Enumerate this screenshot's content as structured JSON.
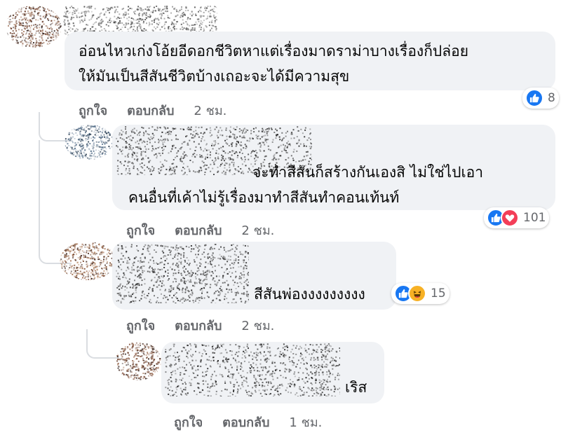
{
  "comments": [
    {
      "text_lines": [
        "อ่อนไหวเก่งโอ้ยอีดอกชีวิตหาแต่เรื่องมาดราม่าบางเรื่องก็ปล่อย",
        "ให้มันเป็นสีสันชีวิตบ้างเถอะจะได้มีความสุข"
      ],
      "like_label": "ถูกใจ",
      "reply_label": "ตอบกลับ",
      "time": "2 ชม.",
      "reaction_icons": [
        "like-icon"
      ],
      "reaction_count": "8"
    },
    {
      "text_lines": [
        "จะทำสีสันก็สร้างกันเองสิ ไม่ใช่ไปเอา",
        "คนอื่นที่เค้าไม่รู้เรื่องมาทำสีสันทำคอนเท้นท์"
      ],
      "like_label": "ถูกใจ",
      "reply_label": "ตอบกลับ",
      "time": "2 ชม.",
      "reaction_icons": [
        "like-icon",
        "love-icon"
      ],
      "reaction_count": "101"
    },
    {
      "text_lines": [
        "สีสันพ่องงงงงงงงง"
      ],
      "like_label": "ถูกใจ",
      "reply_label": "ตอบกลับ",
      "time": "2 ชม.",
      "reaction_icons": [
        "like-icon",
        "haha-icon"
      ],
      "reaction_count": "15"
    },
    {
      "text_lines": [
        "เริส"
      ],
      "like_label": "ถูกใจ",
      "reply_label": "ตอบกลับ",
      "time": "1 ชม."
    }
  ],
  "colors": {
    "bubble": "#f0f2f5",
    "meta_text": "#65676b",
    "like": "#1877f2",
    "love": "#f33e58",
    "haha": "#f7b125"
  }
}
